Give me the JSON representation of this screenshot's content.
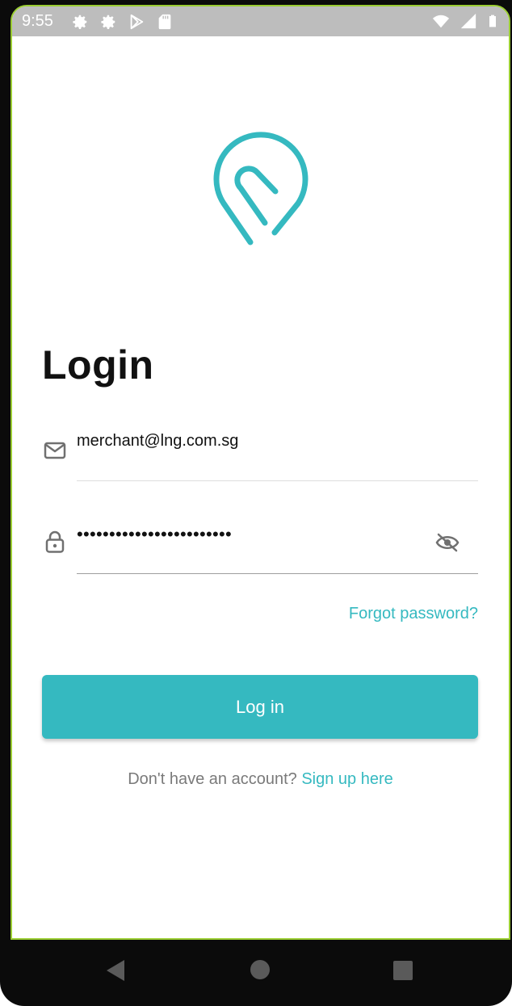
{
  "status_bar": {
    "time": "9:55",
    "left_icons": [
      "gear-icon",
      "gear-icon",
      "play-store-icon",
      "sd-card-icon"
    ],
    "right_icons": [
      "wifi-icon",
      "signal-icon",
      "battery-icon"
    ]
  },
  "app": {
    "logo": "location-pin-logo",
    "title": "Login",
    "email": {
      "icon": "mail-icon",
      "value": "merchant@lng.com.sg"
    },
    "password": {
      "icon": "lock-icon",
      "value": "••••••••••••••••••••••••",
      "toggle_icon": "eye-off-icon"
    },
    "forgot_password": "Forgot password?",
    "login_button": "Log in",
    "signup_prompt": "Don't have an account?",
    "signup_link": "Sign up here"
  },
  "colors": {
    "accent": "#35b9c0",
    "status_bar": "#bdbdbd",
    "title": "#111111",
    "muted_text": "#7a7a7a"
  },
  "nav_bar": {
    "buttons": [
      "back-triangle-icon",
      "home-circle-icon",
      "recents-square-icon"
    ]
  }
}
